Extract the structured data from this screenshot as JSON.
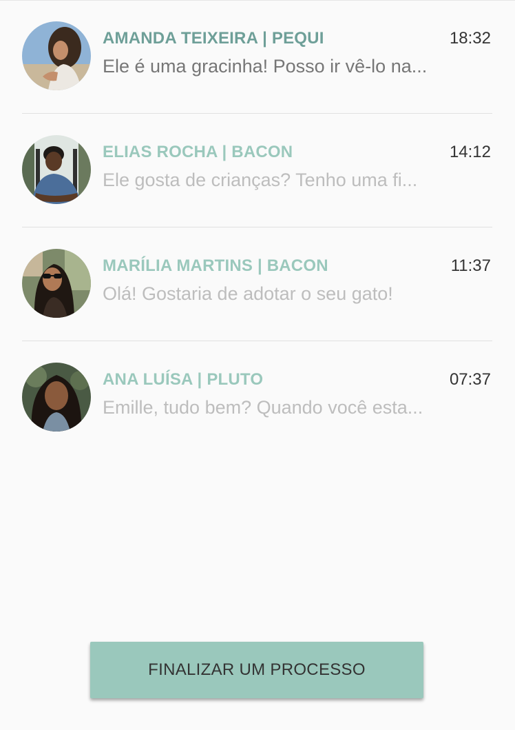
{
  "chats": [
    {
      "name": "AMANDA TEIXEIRA | PEQUI",
      "time": "18:32",
      "preview": "Ele é uma gracinha! Posso ir vê-lo na...",
      "unread": true,
      "avatar_icon": "avatar-amanda"
    },
    {
      "name": "ELIAS ROCHA | BACON",
      "time": "14:12",
      "preview": "Ele gosta de crianças? Tenho uma fi...",
      "unread": false,
      "avatar_icon": "avatar-elias"
    },
    {
      "name": "MARÍLIA MARTINS | BACON",
      "time": "11:37",
      "preview": "Olá! Gostaria de adotar o seu gato!",
      "unread": false,
      "avatar_icon": "avatar-marilia"
    },
    {
      "name": "ANA LUÍSA | PLUTO",
      "time": "07:37",
      "preview": "Emille, tudo bem? Quando você esta...",
      "unread": false,
      "avatar_icon": "avatar-ana"
    }
  ],
  "finish_button_label": "FINALIZAR UM PROCESSO",
  "colors": {
    "accent": "#9ac8bc",
    "unread_name": "#6e9f98",
    "read_text": "#bdbdbd",
    "unread_text": "#767676",
    "time_text": "#333333",
    "background": "#fafafa"
  }
}
